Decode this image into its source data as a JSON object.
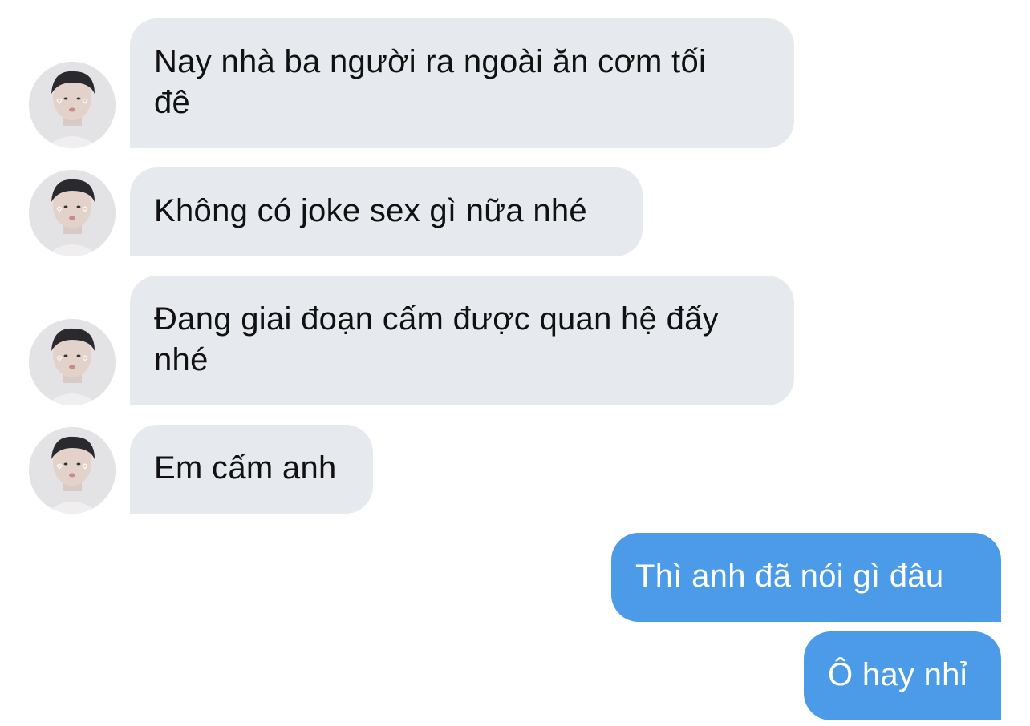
{
  "incoming_messages": [
    {
      "text": "Nay nhà ba người ra ngoài ăn cơm tối đê"
    },
    {
      "text": "Không có joke sex gì nữa nhé"
    },
    {
      "text": "Đang giai đoạn cấm được quan hệ đấy nhé"
    },
    {
      "text": "Em cấm anh"
    }
  ],
  "outgoing_messages": [
    {
      "text": "Thì anh đã nói gì đâu"
    },
    {
      "text": "Ô hay nhỉ"
    }
  ],
  "colors": {
    "incoming_bubble": "#e6eaee",
    "outgoing_bubble": "#4c9be8",
    "background": "#ffffff"
  },
  "icons": {
    "avatar": "contact-avatar"
  }
}
